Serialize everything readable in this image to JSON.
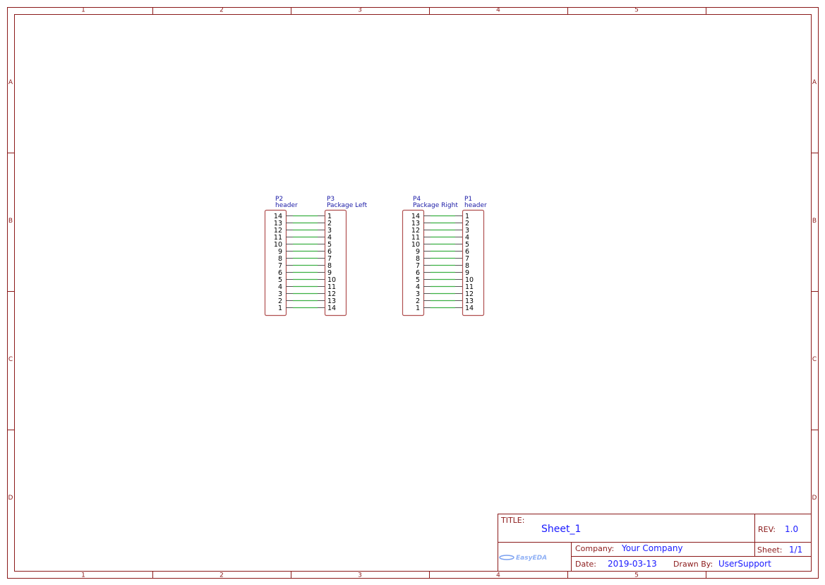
{
  "colors": {
    "frame": "#8b1a1a",
    "wire": "#3cb043",
    "pin": "#555555",
    "body": "#b05050",
    "ref": "#1a1aa6",
    "value": "#1a1aff"
  },
  "border": {
    "columns": [
      "1",
      "2",
      "3",
      "4",
      "5"
    ],
    "rows": [
      "A",
      "B",
      "C",
      "D"
    ]
  },
  "components": [
    {
      "ref": "P2",
      "value": "header",
      "pins": [
        "14",
        "13",
        "12",
        "11",
        "10",
        "9",
        "8",
        "7",
        "6",
        "5",
        "4",
        "3",
        "2",
        "1"
      ]
    },
    {
      "ref": "P3",
      "value": "Package Left",
      "pins": [
        "1",
        "2",
        "3",
        "4",
        "5",
        "6",
        "7",
        "8",
        "9",
        "10",
        "11",
        "12",
        "13",
        "14"
      ]
    },
    {
      "ref": "P4",
      "value": "Package Right",
      "pins": [
        "14",
        "13",
        "12",
        "11",
        "10",
        "9",
        "8",
        "7",
        "6",
        "5",
        "4",
        "3",
        "2",
        "1"
      ]
    },
    {
      "ref": "P1",
      "value": "header",
      "pins": [
        "1",
        "2",
        "3",
        "4",
        "5",
        "6",
        "7",
        "8",
        "9",
        "10",
        "11",
        "12",
        "13",
        "14"
      ]
    }
  ],
  "title_block": {
    "title_label": "TITLE:",
    "title": "Sheet_1",
    "rev_label": "REV:",
    "rev": "1.0",
    "company_label": "Company:",
    "company": "Your Company",
    "sheet_label": "Sheet:",
    "sheet": "1/1",
    "date_label": "Date:",
    "date": "2019-03-13",
    "drawn_by_label": "Drawn By:",
    "drawn_by": "UserSupport",
    "logo_text": "EasyEDA"
  }
}
